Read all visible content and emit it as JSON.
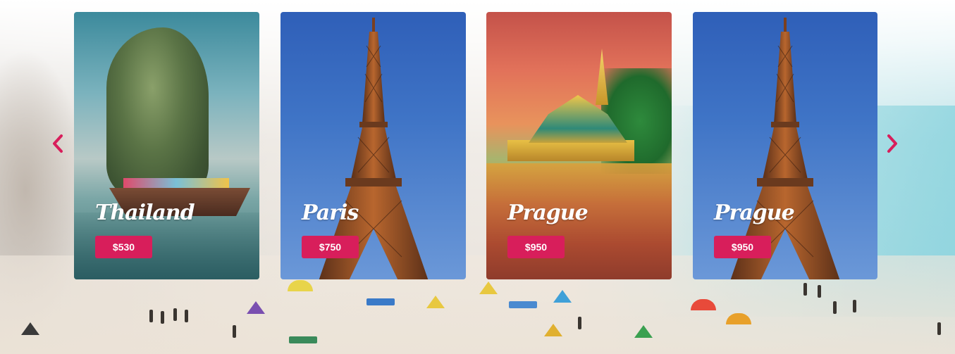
{
  "carousel": {
    "prev_icon": "chevron-left-icon",
    "next_icon": "chevron-right-icon",
    "accent_color": "#d81e5b",
    "cards": [
      {
        "title": "Thailand",
        "price": "$530",
        "image": "thailand-rock-boat"
      },
      {
        "title": "Paris",
        "price": "$750",
        "image": "eiffel-tower"
      },
      {
        "title": "Prague",
        "price": "$950",
        "image": "golden-pagoda"
      },
      {
        "title": "Prague",
        "price": "$950",
        "image": "eiffel-tower"
      }
    ]
  }
}
